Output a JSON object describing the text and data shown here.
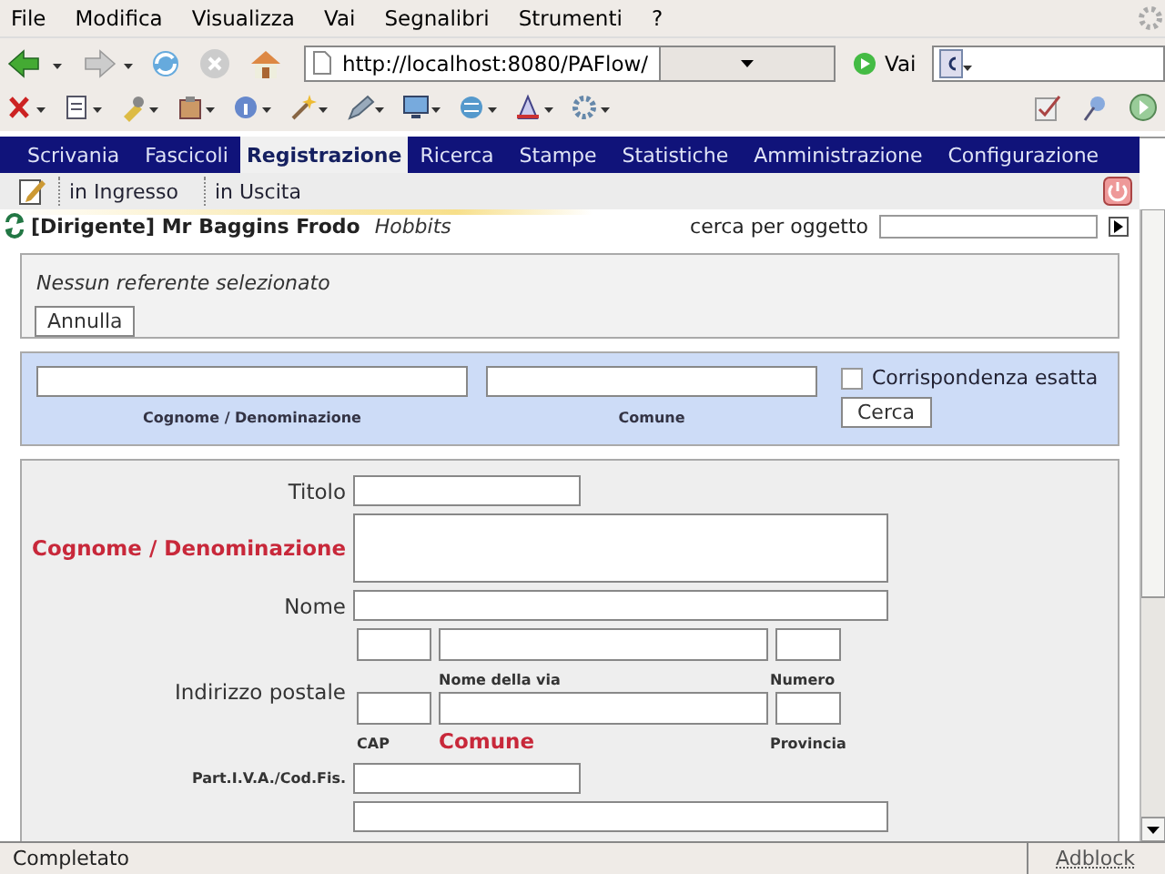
{
  "menu_bar": [
    "File",
    "Modifica",
    "Visualizza",
    "Vai",
    "Segnalibri",
    "Strumenti",
    "?"
  ],
  "navigation": {
    "url": "http://localhost:8080/PAFlow/",
    "go_button": "Vai"
  },
  "tabs": [
    {
      "label": "Scrivania",
      "selected": false
    },
    {
      "label": "Fascicoli",
      "selected": false
    },
    {
      "label": "Registrazione",
      "selected": true
    },
    {
      "label": "Ricerca",
      "selected": false
    },
    {
      "label": "Stampe",
      "selected": false
    },
    {
      "label": "Statistiche",
      "selected": false
    },
    {
      "label": "Amministrazione",
      "selected": false
    },
    {
      "label": "Configurazione",
      "selected": false
    }
  ],
  "subtabs": [
    "in Ingresso",
    "in Uscita"
  ],
  "user": {
    "name": "[Dirigente] Mr Baggins Frodo",
    "group": "Hobbits"
  },
  "quick_search": {
    "label": "cerca per oggetto"
  },
  "referent_panel": {
    "message": "Nessun referente selezionato",
    "button": "Annulla"
  },
  "search_panel": {
    "fields": [
      {
        "label": "Cognome / Denominazione"
      },
      {
        "label": "Comune"
      }
    ],
    "checkbox": {
      "label": "Corrispondenza esatta",
      "checked": false
    },
    "button": "Cerca"
  },
  "form": {
    "fields": [
      {
        "kind": "short",
        "label": "Titolo",
        "required": false
      },
      {
        "kind": "area",
        "label": "Cognome / Denominazione",
        "required": true
      },
      {
        "kind": "long",
        "label": "Nome",
        "required": false
      },
      {
        "kind": "address",
        "label": "Indirizzo postale",
        "required": false,
        "rows": [
          [
            {
              "kind": "small"
            },
            {
              "kind": "wide",
              "label": "Nome della via",
              "required": false
            },
            {
              "kind": "small",
              "label": "Numero",
              "required": false
            }
          ],
          [
            {
              "kind": "small",
              "label": "CAP",
              "required": false
            },
            {
              "kind": "wide",
              "label": "Comune",
              "required": true
            },
            {
              "kind": "small",
              "label": "Provincia",
              "required": false
            }
          ]
        ]
      },
      {
        "kind": "code",
        "label": "Part.I.V.A./Cod.Fis.",
        "required": false
      },
      {
        "kind": "long"
      }
    ]
  },
  "status_bar": {
    "text": "Completato",
    "addon": "Adblock"
  }
}
